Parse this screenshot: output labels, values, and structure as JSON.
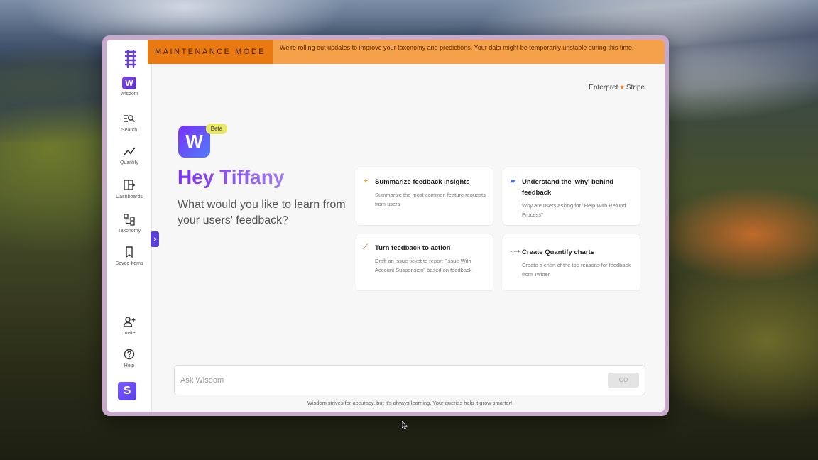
{
  "banner": {
    "label": "MAINTENANCE MODE",
    "message": "We're rolling out updates to improve your taxonomy and predictions. Your data might be temporarily unstable during this time."
  },
  "sidebar": {
    "items": [
      {
        "label": "Wisdom",
        "icon": "wisdom-icon"
      },
      {
        "label": "Search",
        "icon": "search-icon"
      },
      {
        "label": "Quantify",
        "icon": "quantify-icon"
      },
      {
        "label": "Dashboards",
        "icon": "dashboards-icon"
      },
      {
        "label": "Taxonomy",
        "icon": "taxonomy-icon"
      },
      {
        "label": "Saved Items",
        "icon": "bookmark-icon"
      },
      {
        "label": "Invite",
        "icon": "add-user-icon"
      },
      {
        "label": "Help",
        "icon": "help-icon"
      }
    ],
    "org_badge": "S"
  },
  "org": {
    "name_left": "Enterpret",
    "name_right": "Stripe"
  },
  "hero": {
    "badge": "Beta",
    "greeting": "Hey Tiffany",
    "prompt": "What would you like to learn from your users' feedback?"
  },
  "cards": [
    {
      "title": "Summarize feedback insights",
      "desc": "Summarize the most common feature requests from users",
      "icon": "sparkle-icon"
    },
    {
      "title": "Understand the 'why' behind feedback",
      "desc": "Why are users asking for \"Help With Refund Process\"",
      "icon": "chat-icon"
    },
    {
      "title": "Turn feedback to action",
      "desc": "Draft an issue ticket to report \"Issue With Account Suspension\" based on feedback",
      "icon": "magic-wand-icon"
    },
    {
      "title": "Create Quantify charts",
      "desc": "Create a chart of the top reasons for feedback from Twitter",
      "icon": "trend-icon"
    }
  ],
  "ask": {
    "placeholder": "Ask Wisdom",
    "go_label": "GO"
  },
  "disclaimer": "Wisdom strives for accuracy, but it's always learning. Your queries help it grow smarter!",
  "colors": {
    "accent": "#6a3fd6",
    "banner_label": "#e97a12",
    "banner_msg": "#f5a14a",
    "frame": "#c7a9cc"
  }
}
